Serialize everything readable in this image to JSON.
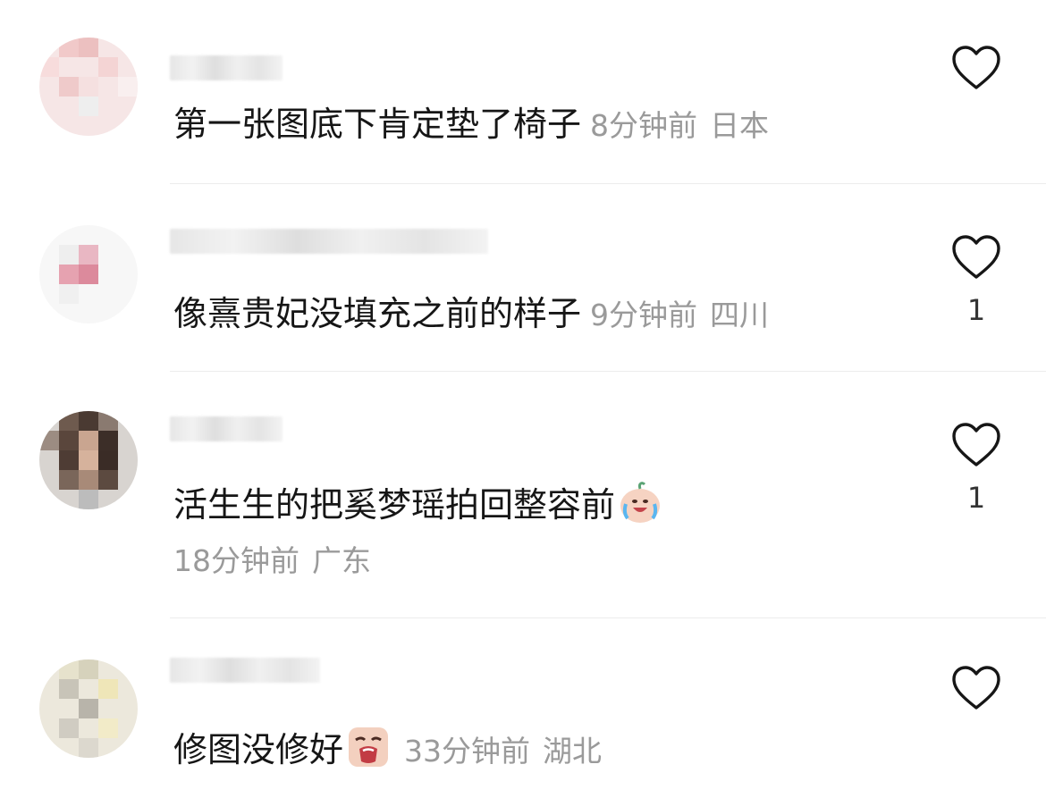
{
  "comments": [
    {
      "text": "第一张图底下肯定垫了椅子",
      "time": "8分钟前",
      "location": "日本",
      "likes": ""
    },
    {
      "text": "像熹贵妃没填充之前的样子",
      "time": "9分钟前",
      "location": "四川",
      "likes": "1"
    },
    {
      "text": "活生生的把奚梦瑶拍回整容前",
      "time": "18分钟前",
      "location": "广东",
      "likes": "1"
    },
    {
      "text": "修图没修好",
      "time": "33分钟前",
      "location": "湖北",
      "likes": ""
    }
  ],
  "icons": {
    "like": "heart-outline-icon",
    "crying_laugh": "crying-laugh-emoji",
    "sob": "sob-emoji"
  }
}
